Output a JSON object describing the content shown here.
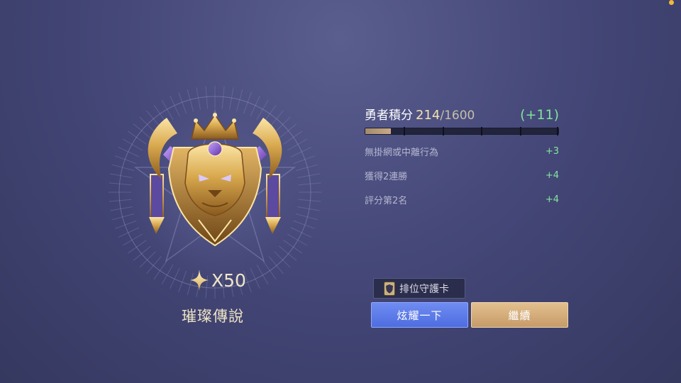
{
  "rank": {
    "name": "璀璨傳說",
    "stars_label": "X50",
    "emblem_icon": "lion-shield-crown-emblem",
    "star_icon": "four-point-star-icon"
  },
  "score": {
    "title": "勇者積分",
    "current": "214",
    "max": "/1600",
    "gain": "(+11)",
    "progress_fraction": 0.134,
    "details": [
      {
        "label": "無掛網或中離行為",
        "value": "+3"
      },
      {
        "label": "獲得2連勝",
        "value": "+4"
      },
      {
        "label": "評分第2名",
        "value": "+4"
      }
    ]
  },
  "guard_card": {
    "label": "排位守護卡",
    "icon": "shield-card-icon"
  },
  "buttons": {
    "share_label": "炫耀一下",
    "continue_label": "繼續"
  },
  "colors": {
    "background": "#454879",
    "accent_gold": "#f3e1b3",
    "gain_green": "#7ee39a",
    "share_blue": "#5a78e8",
    "continue_gold": "#d3ad7b"
  }
}
